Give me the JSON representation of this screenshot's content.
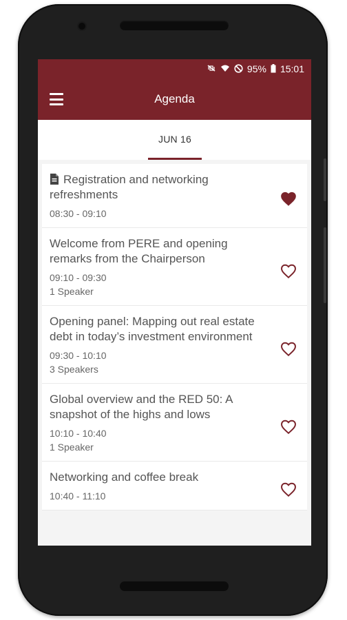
{
  "status_bar": {
    "battery": "95%",
    "time": "15:01",
    "icons": [
      "vibrate-off-icon",
      "wifi-icon",
      "do-not-disturb-icon",
      "battery-icon"
    ]
  },
  "toolbar": {
    "title": "Agenda",
    "menu_icon": "hamburger-menu-icon"
  },
  "tabs": [
    {
      "label": "JUN 16",
      "selected": true
    }
  ],
  "colors": {
    "brand": "#7a232a",
    "heart": "#7a232a"
  },
  "agenda": [
    {
      "title": "Registration and networking refreshments",
      "time": "08:30 - 09:10",
      "speakers": "",
      "favorite": true,
      "has_doc_icon": true
    },
    {
      "title": "Welcome from PERE and opening remarks from the Chairperson",
      "time": "09:10 - 09:30",
      "speakers": "1 Speaker",
      "favorite": false,
      "has_doc_icon": false
    },
    {
      "title": "Opening panel: Mapping out real estate debt in today’s investment environment",
      "time": "09:30 - 10:10",
      "speakers": "3 Speakers",
      "favorite": false,
      "has_doc_icon": false
    },
    {
      "title": "Global overview and the RED 50: A snapshot of the highs and lows",
      "time": "10:10 - 10:40",
      "speakers": "1 Speaker",
      "favorite": false,
      "has_doc_icon": false
    },
    {
      "title": "Networking and coffee break",
      "time": "10:40 - 11:10",
      "speakers": "",
      "favorite": false,
      "has_doc_icon": false
    }
  ]
}
